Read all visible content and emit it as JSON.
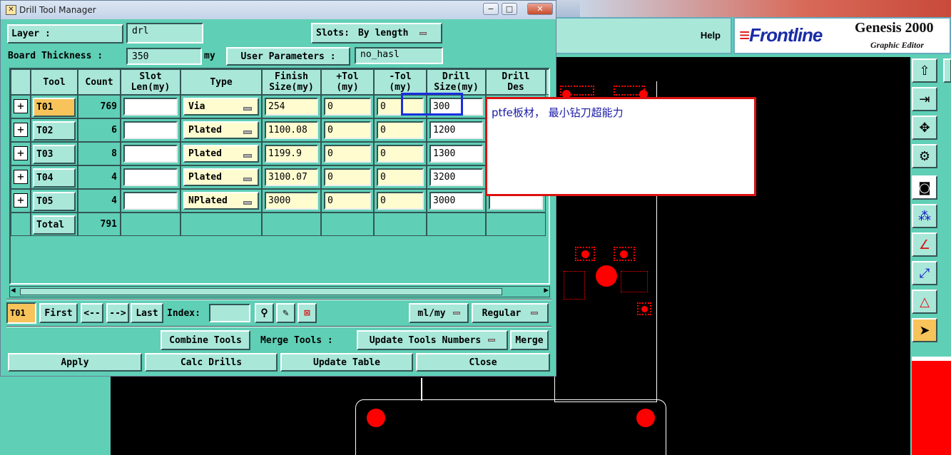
{
  "dialog": {
    "title": "Drill Tool Manager",
    "win_min": "−",
    "win_max": "□",
    "win_close": "✕",
    "layer_label": "Layer          :",
    "layer_value": "drl",
    "slots_label": "Slots:",
    "slots_value": "By length",
    "board_thickness_label": "Board Thickness :",
    "board_thickness_value": "350",
    "thickness_unit": "my",
    "user_params_label": "User Parameters :",
    "user_params_value": "no_hasl"
  },
  "table": {
    "headers": {
      "tool": "Tool",
      "count": "Count",
      "slot_len_1": "Slot",
      "slot_len_2": "Len(my)",
      "type": "Type",
      "finish_1": "Finish",
      "finish_2": "Size(my)",
      "ptol_1": "+Tol",
      "ptol_2": "(my)",
      "ntol_1": "-Tol",
      "ntol_2": "(my)",
      "drill_1": "Drill",
      "drill_2": "Size(my)",
      "des_1": "Drill",
      "des_2": "Des"
    },
    "rows": [
      {
        "tool": "T01",
        "count": "769",
        "slot": "",
        "type": "Via",
        "finish": "254",
        "ptol": "0",
        "ntol": "0",
        "drill": "300",
        "des": ""
      },
      {
        "tool": "T02",
        "count": "6",
        "slot": "",
        "type": "Plated",
        "finish": "1100.08",
        "ptol": "0",
        "ntol": "0",
        "drill": "1200",
        "des": ""
      },
      {
        "tool": "T03",
        "count": "8",
        "slot": "",
        "type": "Plated",
        "finish": "1199.9",
        "ptol": "0",
        "ntol": "0",
        "drill": "1300",
        "des": ""
      },
      {
        "tool": "T04",
        "count": "4",
        "slot": "",
        "type": "Plated",
        "finish": "3100.07",
        "ptol": "0",
        "ntol": "0",
        "drill": "3200",
        "des": ""
      },
      {
        "tool": "T05",
        "count": "4",
        "slot": "",
        "type": "NPlated",
        "finish": "3000",
        "ptol": "0",
        "ntol": "0",
        "drill": "3000",
        "des": ""
      }
    ],
    "total_label": "Total",
    "total_count": "791",
    "selected_tool": "T01"
  },
  "nav": {
    "current": "T01",
    "first": "First",
    "prev": "<--",
    "next": "-->",
    "last": "Last",
    "index_label": "Index:",
    "index_value": "",
    "units": "ml/my",
    "mode": "Regular"
  },
  "actions": {
    "combine": "Combine Tools",
    "merge_tools_label": "Merge Tools :",
    "merge_option": "Update Tools Numbers",
    "merge": "Merge",
    "apply": "Apply",
    "calc": "Calc Drills",
    "update": "Update Table",
    "close": "Close"
  },
  "annotation": {
    "text": "ptfe板材， 最小钻刀超能力"
  },
  "genesis": {
    "help": "Help",
    "logo": "Frontline",
    "title": "Genesis 2000",
    "subtitle": "Graphic Editor"
  },
  "colors": {
    "teal": "#5fcfb6",
    "highlight_tool": "#f7c35a",
    "annotation_border": "#d11111",
    "highlight_box": "#1b2fe0"
  }
}
